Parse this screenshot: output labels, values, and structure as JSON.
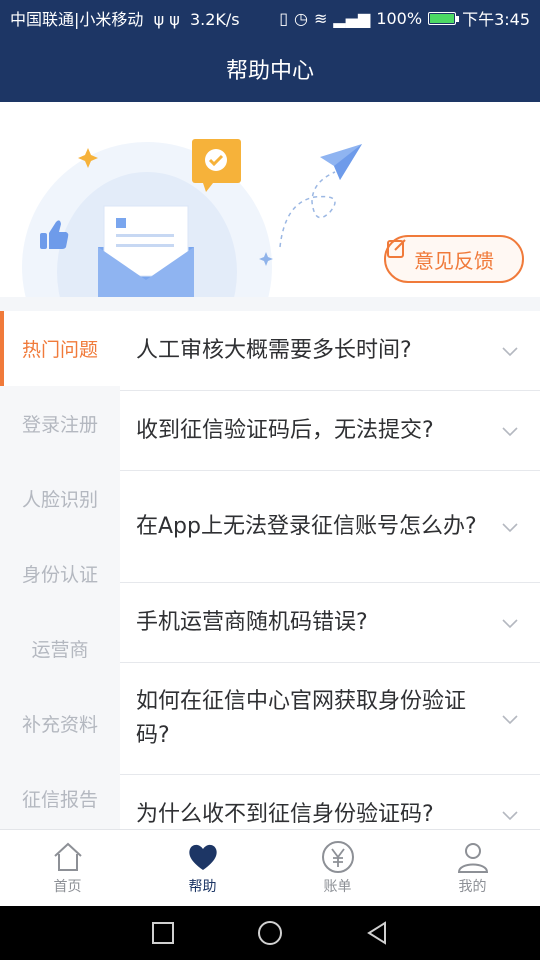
{
  "status_bar": {
    "carrier": "中国联通|小米移动",
    "net_speed": "3.2K/s",
    "battery_level": "100%",
    "time": "下午3:45",
    "battery_fraction": 1.0
  },
  "header": {
    "title": "帮助中心"
  },
  "banner": {
    "feedback_label": "意见反馈"
  },
  "categories": [
    {
      "label": "热门问题",
      "active": true
    },
    {
      "label": "登录注册"
    },
    {
      "label": "人脸识别"
    },
    {
      "label": "身份认证"
    },
    {
      "label": "运营商"
    },
    {
      "label": "补充资料"
    },
    {
      "label": "征信报告"
    }
  ],
  "questions": [
    {
      "text": "人工审核大概需要多长时间?"
    },
    {
      "text": "收到征信验证码后，无法提交?"
    },
    {
      "text": "在App上无法登录征信账号怎么办?"
    },
    {
      "text": "手机运营商随机码错误?"
    },
    {
      "text": "如何在征信中心官网获取身份验证码?"
    },
    {
      "text": "为什么收不到征信身份验证码?"
    }
  ],
  "tabs": [
    {
      "label": "首页",
      "icon": "home-icon"
    },
    {
      "label": "帮助",
      "icon": "heart-icon",
      "active": true
    },
    {
      "label": "账单",
      "icon": "yuan-icon"
    },
    {
      "label": "我的",
      "icon": "user-icon"
    }
  ],
  "colors": {
    "header_bg": "#1d3665",
    "accent": "#f07a3a",
    "active_tab": "#1d3665"
  }
}
